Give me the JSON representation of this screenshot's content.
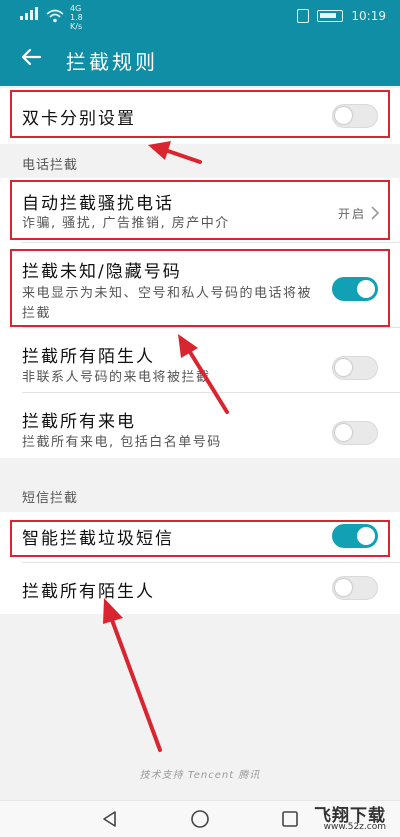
{
  "status_bar": {
    "network": "4G\n1.8\nK/s",
    "time": "10:19"
  },
  "header": {
    "title": "拦截规则"
  },
  "rows": {
    "dual_sim": {
      "title": "双卡分别设置",
      "enabled": false
    },
    "auto_block": {
      "title": "自动拦截骚扰电话",
      "subtitle": "诈骗, 骚扰, 广告推销, 房产中介",
      "status": "开启"
    },
    "unknown_hidden": {
      "title": "拦截未知/隐藏号码",
      "subtitle": "来电显示为未知、空号和私人号码的电话将被拦截",
      "enabled": true
    },
    "all_strangers_calls": {
      "title": "拦截所有陌生人",
      "subtitle": "非联系人号码的来电将被拦截",
      "enabled": false
    },
    "all_calls": {
      "title": "拦截所有来电",
      "subtitle": "拦截所有来电, 包括白名单号码",
      "enabled": false
    },
    "smart_sms": {
      "title": "智能拦截垃圾短信",
      "enabled": true
    },
    "all_strangers_sms": {
      "title": "拦截所有陌生人",
      "enabled": false
    }
  },
  "sections": {
    "calls": "电话拦截",
    "sms": "短信拦截"
  },
  "footer": {
    "powered_by": "技术支持 Tencent 腾讯"
  },
  "watermark": {
    "brand": "飞翔下载",
    "url": "www.52z.com"
  },
  "colors": {
    "primary": "#0f8ea5",
    "toggle_on": "#12a0b5",
    "highlight": "#d9252f"
  }
}
